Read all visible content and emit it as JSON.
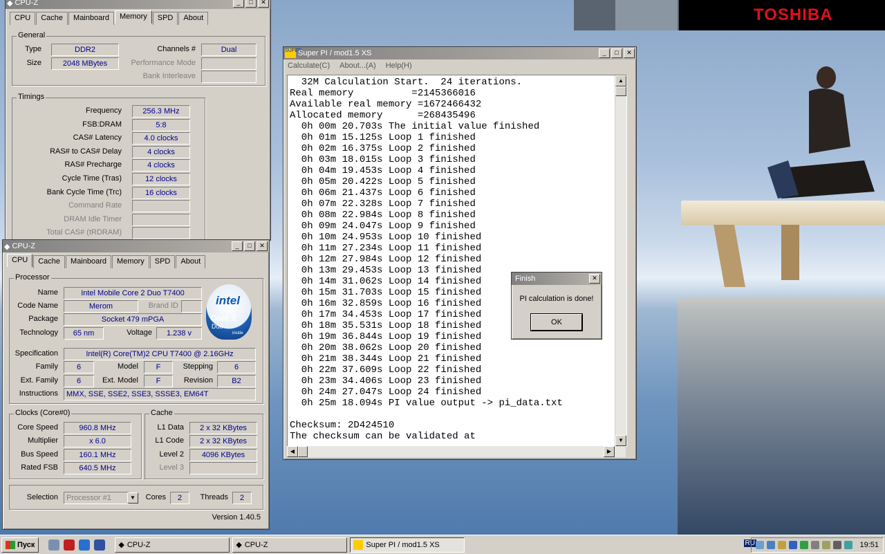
{
  "desktop": {
    "brand": "TOSHIBA"
  },
  "cpuz_memory": {
    "title": "CPU-Z",
    "tabs": [
      "CPU",
      "Cache",
      "Mainboard",
      "Memory",
      "SPD",
      "About"
    ],
    "selected_tab": "Memory",
    "general": {
      "label": "General",
      "type_label": "Type",
      "type": "DDR2",
      "size_label": "Size",
      "size": "2048 MBytes",
      "channels_label": "Channels #",
      "channels": "Dual",
      "perf_mode_label": "Performance Mode",
      "perf_mode": "",
      "bank_interleave_label": "Bank Interleave",
      "bank_interleave": ""
    },
    "timings": {
      "label": "Timings",
      "rows": [
        {
          "label": "Frequency",
          "value": "256.3 MHz",
          "dim": false
        },
        {
          "label": "FSB:DRAM",
          "value": "5:8",
          "dim": false
        },
        {
          "label": "CAS# Latency",
          "value": "4.0 clocks",
          "dim": false
        },
        {
          "label": "RAS# to CAS# Delay",
          "value": "4 clocks",
          "dim": false
        },
        {
          "label": "RAS# Precharge",
          "value": "4 clocks",
          "dim": false
        },
        {
          "label": "Cycle Time (Tras)",
          "value": "12 clocks",
          "dim": false
        },
        {
          "label": "Bank Cycle Time (Trc)",
          "value": "16 clocks",
          "dim": false
        },
        {
          "label": "Command Rate",
          "value": "",
          "dim": true
        },
        {
          "label": "DRAM Idle Timer",
          "value": "",
          "dim": true
        },
        {
          "label": "Total CAS# (tRDRAM)",
          "value": "",
          "dim": true
        }
      ]
    }
  },
  "cpuz_cpu": {
    "title": "CPU-Z",
    "tabs": [
      "CPU",
      "Cache",
      "Mainboard",
      "Memory",
      "SPD",
      "About"
    ],
    "selected_tab": "CPU",
    "processor": {
      "label": "Processor",
      "name_label": "Name",
      "name": "Intel Mobile Core 2 Duo T7400",
      "codename_label": "Code Name",
      "codename": "Merom",
      "brandid_label": "Brand ID",
      "brandid": "",
      "package_label": "Package",
      "package": "Socket 479 mPGA",
      "technology_label": "Technology",
      "technology": "65 nm",
      "voltage_label": "Voltage",
      "voltage": "1.238 v",
      "spec_label": "Specification",
      "spec": "Intel(R) Core(TM)2 CPU        T7400  @ 2.16GHz",
      "family_label": "Family",
      "family": "6",
      "model_label": "Model",
      "model": "F",
      "stepping_label": "Stepping",
      "stepping": "6",
      "extfamily_label": "Ext. Family",
      "extfamily": "6",
      "extmodel_label": "Ext. Model",
      "extmodel": "F",
      "revision_label": "Revision",
      "revision": "B2",
      "instructions_label": "Instructions",
      "instructions": "MMX, SSE, SSE2, SSE3, SSSE3, EM64T"
    },
    "logo": {
      "intel": "intel",
      "core": "Core 2",
      "duo": "Duo",
      "inside": "inside"
    },
    "clocks": {
      "label": "Clocks (Core#0)",
      "core_speed_label": "Core Speed",
      "core_speed": "960.8 MHz",
      "multiplier_label": "Multiplier",
      "multiplier": "x 6.0",
      "bus_speed_label": "Bus Speed",
      "bus_speed": "160.1 MHz",
      "rated_fsb_label": "Rated FSB",
      "rated_fsb": "640.5 MHz"
    },
    "cache": {
      "label": "Cache",
      "l1data_label": "L1 Data",
      "l1data": "2 x 32 KBytes",
      "l1code_label": "L1 Code",
      "l1code": "2 x 32 KBytes",
      "level2_label": "Level 2",
      "level2": "4096 KBytes",
      "level3_label": "Level 3",
      "level3": ""
    },
    "selection_label": "Selection",
    "selection": "Processor #1",
    "cores_label": "Cores",
    "cores": "2",
    "threads_label": "Threads",
    "threads": "2",
    "version": "Version 1.40.5"
  },
  "superpi": {
    "title": "Super PI / mod1.5 XS",
    "icon_text": "SUPER",
    "menu": [
      "Calculate(C)",
      "About...(A)",
      "Help(H)"
    ],
    "output": "  32M Calculation Start.  24 iterations.\nReal memory          =2145366016\nAvailable real memory =1672466432\nAllocated memory      =268435496\n  0h 00m 20.703s The initial value finished\n  0h 01m 15.125s Loop 1 finished\n  0h 02m 16.375s Loop 2 finished\n  0h 03m 18.015s Loop 3 finished\n  0h 04m 19.453s Loop 4 finished\n  0h 05m 20.422s Loop 5 finished\n  0h 06m 21.437s Loop 6 finished\n  0h 07m 22.328s Loop 7 finished\n  0h 08m 22.984s Loop 8 finished\n  0h 09m 24.047s Loop 9 finished\n  0h 10m 24.953s Loop 10 finished\n  0h 11m 27.234s Loop 11 finished\n  0h 12m 27.984s Loop 12 finished\n  0h 13m 29.453s Loop 13 finished\n  0h 14m 31.062s Loop 14 finished\n  0h 15m 31.703s Loop 15 finished\n  0h 16m 32.859s Loop 16 finished\n  0h 17m 34.453s Loop 17 finished\n  0h 18m 35.531s Loop 18 finished\n  0h 19m 36.844s Loop 19 finished\n  0h 20m 38.062s Loop 20 finished\n  0h 21m 38.344s Loop 21 finished\n  0h 22m 37.609s Loop 22 finished\n  0h 23m 34.406s Loop 23 finished\n  0h 24m 27.047s Loop 24 finished\n  0h 25m 18.094s PI value output -> pi_data.txt\n\nChecksum: 2D424510\nThe checksum can be validated at"
  },
  "finish_dialog": {
    "title": "Finish",
    "message": "PI calculation is done!",
    "ok": "OK"
  },
  "taskbar": {
    "start": "Пуск",
    "tasks": [
      "CPU-Z",
      "CPU-Z",
      "Super PI / mod1.5 XS"
    ],
    "lang": "RU",
    "clock": "19:51"
  }
}
